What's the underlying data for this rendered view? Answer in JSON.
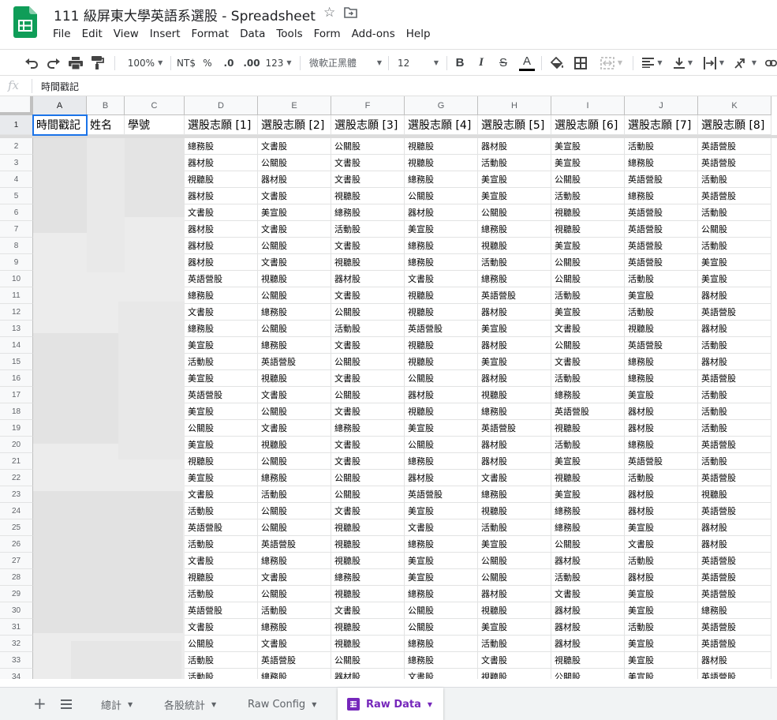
{
  "app": {
    "title": "111 級屏東大學英語系選股 - Spreadsheet",
    "menu": [
      "File",
      "Edit",
      "View",
      "Insert",
      "Format",
      "Data",
      "Tools",
      "Form",
      "Add-ons",
      "Help"
    ],
    "brand_color": "#0f9d58"
  },
  "toolbar": {
    "zoom": "100%",
    "currency": "NT$",
    "percent": "%",
    "decrease_decimals": ".0",
    "increase_decimals": ".00",
    "number_format": "123",
    "font": "微軟正黑體",
    "font_size": "12",
    "bold": "B",
    "italic": "I",
    "strikethrough": "S",
    "text_color": "A"
  },
  "formula_bar": {
    "fx": "fx",
    "value": "時間戳記"
  },
  "grid": {
    "columns": [
      "A",
      "B",
      "C",
      "D",
      "E",
      "F",
      "G",
      "H",
      "I",
      "J",
      "K"
    ],
    "headers": [
      "時間戳記",
      "姓名",
      "學號",
      "選股志願 [1]",
      "選股志願 [2]",
      "選股志願 [3]",
      "選股志願 [4]",
      "選股志願 [5]",
      "選股志願 [6]",
      "選股志願 [7]",
      "選股志願 [8]"
    ],
    "rows": [
      {
        "n": "2",
        "v": [
          "總務股",
          "文書股",
          "公關股",
          "視聽股",
          "器材股",
          "美宣股",
          "活動股",
          "英語營股"
        ]
      },
      {
        "n": "3",
        "v": [
          "器材股",
          "公關股",
          "文書股",
          "視聽股",
          "活動股",
          "美宣股",
          "總務股",
          "英語營股"
        ]
      },
      {
        "n": "4",
        "v": [
          "視聽股",
          "器材股",
          "文書股",
          "總務股",
          "美宣股",
          "公關股",
          "英語營股",
          "活動股"
        ]
      },
      {
        "n": "5",
        "v": [
          "器材股",
          "文書股",
          "視聽股",
          "公關股",
          "美宣股",
          "活動股",
          "總務股",
          "英語營股"
        ]
      },
      {
        "n": "6",
        "v": [
          "文書股",
          "美宣股",
          "總務股",
          "器材股",
          "公關股",
          "視聽股",
          "英語營股",
          "活動股"
        ]
      },
      {
        "n": "7",
        "v": [
          "器材股",
          "文書股",
          "活動股",
          "美宣股",
          "總務股",
          "視聽股",
          "英語營股",
          "公關股"
        ]
      },
      {
        "n": "8",
        "v": [
          "器材股",
          "公關股",
          "文書股",
          "總務股",
          "視聽股",
          "美宣股",
          "英語營股",
          "活動股"
        ]
      },
      {
        "n": "9",
        "v": [
          "器材股",
          "文書股",
          "視聽股",
          "總務股",
          "活動股",
          "公關股",
          "英語營股",
          "美宣股"
        ]
      },
      {
        "n": "10",
        "v": [
          "英語營股",
          "視聽股",
          "器材股",
          "文書股",
          "總務股",
          "公關股",
          "活動股",
          "美宣股"
        ]
      },
      {
        "n": "11",
        "v": [
          "總務股",
          "公關股",
          "文書股",
          "視聽股",
          "英語營股",
          "活動股",
          "美宣股",
          "器材股"
        ]
      },
      {
        "n": "12",
        "v": [
          "文書股",
          "總務股",
          "公關股",
          "視聽股",
          "器材股",
          "美宣股",
          "活動股",
          "英語營股"
        ]
      },
      {
        "n": "13",
        "v": [
          "總務股",
          "公關股",
          "活動股",
          "英語營股",
          "美宣股",
          "文書股",
          "視聽股",
          "器材股"
        ]
      },
      {
        "n": "14",
        "v": [
          "美宣股",
          "總務股",
          "文書股",
          "視聽股",
          "器材股",
          "公關股",
          "英語營股",
          "活動股"
        ]
      },
      {
        "n": "15",
        "v": [
          "活動股",
          "英語營股",
          "公關股",
          "視聽股",
          "美宣股",
          "文書股",
          "總務股",
          "器材股"
        ]
      },
      {
        "n": "16",
        "v": [
          "美宣股",
          "視聽股",
          "文書股",
          "公關股",
          "器材股",
          "活動股",
          "總務股",
          "英語營股"
        ]
      },
      {
        "n": "17",
        "v": [
          "英語營股",
          "文書股",
          "公關股",
          "器材股",
          "視聽股",
          "總務股",
          "美宣股",
          "活動股"
        ]
      },
      {
        "n": "18",
        "v": [
          "美宣股",
          "公關股",
          "文書股",
          "視聽股",
          "總務股",
          "英語營股",
          "器材股",
          "活動股"
        ]
      },
      {
        "n": "19",
        "v": [
          "公關股",
          "文書股",
          "總務股",
          "美宣股",
          "英語營股",
          "視聽股",
          "器材股",
          "活動股"
        ]
      },
      {
        "n": "20",
        "v": [
          "美宣股",
          "視聽股",
          "文書股",
          "公關股",
          "器材股",
          "活動股",
          "總務股",
          "英語營股"
        ]
      },
      {
        "n": "21",
        "v": [
          "視聽股",
          "公關股",
          "文書股",
          "總務股",
          "器材股",
          "美宣股",
          "英語營股",
          "活動股"
        ]
      },
      {
        "n": "22",
        "v": [
          "美宣股",
          "總務股",
          "公關股",
          "器材股",
          "文書股",
          "視聽股",
          "活動股",
          "英語營股"
        ]
      },
      {
        "n": "23",
        "v": [
          "文書股",
          "活動股",
          "公關股",
          "英語營股",
          "總務股",
          "美宣股",
          "器材股",
          "視聽股"
        ]
      },
      {
        "n": "24",
        "v": [
          "活動股",
          "公關股",
          "文書股",
          "美宣股",
          "視聽股",
          "總務股",
          "器材股",
          "英語營股"
        ]
      },
      {
        "n": "25",
        "v": [
          "英語營股",
          "公關股",
          "視聽股",
          "文書股",
          "活動股",
          "總務股",
          "美宣股",
          "器材股"
        ]
      },
      {
        "n": "26",
        "v": [
          "活動股",
          "英語營股",
          "視聽股",
          "總務股",
          "美宣股",
          "公關股",
          "文書股",
          "器材股"
        ]
      },
      {
        "n": "27",
        "v": [
          "文書股",
          "總務股",
          "視聽股",
          "美宣股",
          "公關股",
          "器材股",
          "活動股",
          "英語營股"
        ]
      },
      {
        "n": "28",
        "v": [
          "視聽股",
          "文書股",
          "總務股",
          "美宣股",
          "公關股",
          "活動股",
          "器材股",
          "英語營股"
        ]
      },
      {
        "n": "29",
        "v": [
          "活動股",
          "公關股",
          "視聽股",
          "總務股",
          "器材股",
          "文書股",
          "美宣股",
          "英語營股"
        ]
      },
      {
        "n": "30",
        "v": [
          "英語營股",
          "活動股",
          "文書股",
          "公關股",
          "視聽股",
          "器材股",
          "美宣股",
          "總務股"
        ]
      },
      {
        "n": "31",
        "v": [
          "文書股",
          "總務股",
          "視聽股",
          "公關股",
          "美宣股",
          "器材股",
          "活動股",
          "英語營股"
        ]
      },
      {
        "n": "32",
        "v": [
          "公關股",
          "文書股",
          "視聽股",
          "總務股",
          "活動股",
          "器材股",
          "美宣股",
          "英語營股"
        ]
      },
      {
        "n": "33",
        "v": [
          "活動股",
          "英語營股",
          "公關股",
          "總務股",
          "文書股",
          "視聽股",
          "美宣股",
          "器材股"
        ]
      },
      {
        "n": "34",
        "v": [
          "活動股",
          "總務股",
          "器材股",
          "文書股",
          "視聽股",
          "公關股",
          "美宣股",
          "英語營股"
        ]
      }
    ]
  },
  "sheets": [
    {
      "label": "總計",
      "active": false
    },
    {
      "label": "各股統計",
      "active": false
    },
    {
      "label": "Raw Config",
      "active": false
    },
    {
      "label": "Raw Data",
      "active": true
    }
  ],
  "colors": {
    "selection": "#1a73e8",
    "active_tab": "#7627bb"
  }
}
